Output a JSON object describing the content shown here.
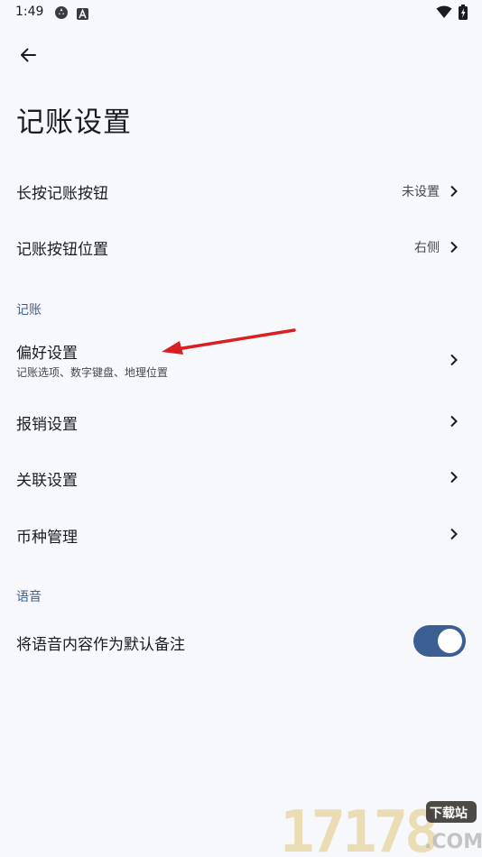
{
  "status_bar": {
    "time": "1:49",
    "icons": [
      "cast-icon",
      "a-badge-icon",
      "wifi-icon",
      "battery-charging-icon"
    ]
  },
  "header": {
    "back_icon": "arrow-left-icon",
    "title": "记账设置"
  },
  "top_items": [
    {
      "title": "长按记账按钮",
      "value": "未设置"
    },
    {
      "title": "记账按钮位置",
      "value": "右侧"
    }
  ],
  "section_bookkeeping": {
    "header": "记账",
    "items": [
      {
        "title": "偏好设置",
        "subtitle": "记账选项、数字键盘、地理位置"
      },
      {
        "title": "报销设置"
      },
      {
        "title": "关联设置"
      },
      {
        "title": "币种管理"
      }
    ]
  },
  "section_voice": {
    "header": "语音",
    "items": [
      {
        "title": "将语音内容作为默认备注",
        "toggle_on": true
      }
    ]
  },
  "colors": {
    "background": "#f7f8fc",
    "accent": "#3b5f92",
    "section_header": "#3f5f90",
    "annotation_arrow": "#d91f1f"
  },
  "watermark": {
    "numbers": "17178",
    "badge": "下载站",
    "domain": ".COM"
  }
}
